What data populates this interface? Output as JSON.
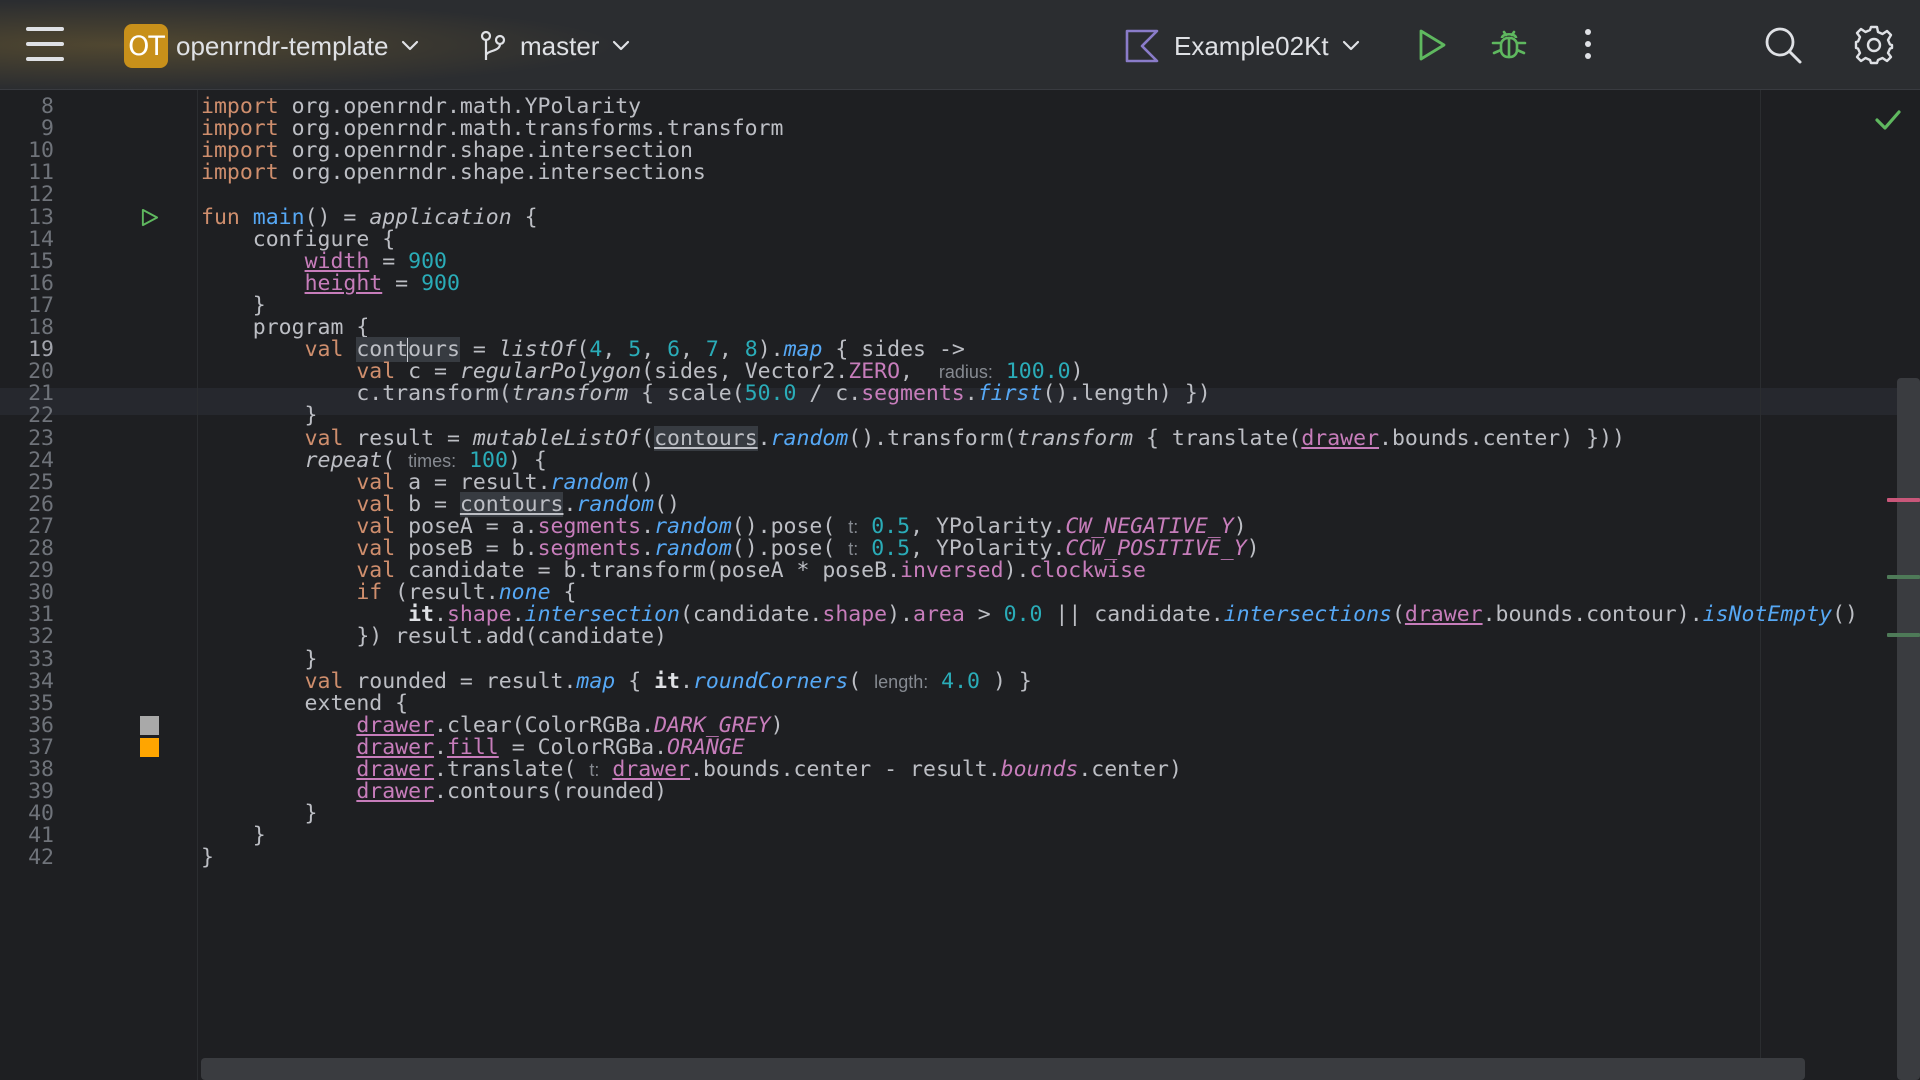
{
  "toolbar": {
    "project_badge": "OT",
    "project_name": "openrndr-template",
    "branch": "master",
    "run_config": "Example02Kt",
    "icons": [
      "menu-icon",
      "chevron-down-icon",
      "branch-icon",
      "kotlin-icon",
      "run-icon",
      "debug-icon",
      "more-icon",
      "search-icon",
      "gear-icon"
    ],
    "colors": {
      "badge": "#c8901a",
      "run": "#5fb85f",
      "debug": "#5fb85f"
    }
  },
  "editor": {
    "current_line": "19",
    "status": "check-icon",
    "colors": {
      "keyword": "#cf8e6d",
      "function": "#56a8f5",
      "number": "#2aacb8",
      "property": "#c77dbb",
      "swatch_grey": "#a9a9a9",
      "swatch_orange": "#ffa500"
    },
    "lines": [
      {
        "n": "8",
        "segs": [
          {
            "t": "import",
            "c": "kw"
          },
          {
            "t": " org.openrndr.math.YPolarity"
          }
        ]
      },
      {
        "n": "9",
        "segs": [
          {
            "t": "import",
            "c": "kw"
          },
          {
            "t": " org.openrndr.math.transforms.transform"
          }
        ]
      },
      {
        "n": "10",
        "segs": [
          {
            "t": "import",
            "c": "kw"
          },
          {
            "t": " org.openrndr.shape.intersection"
          }
        ]
      },
      {
        "n": "11",
        "segs": [
          {
            "t": "import",
            "c": "kw"
          },
          {
            "t": " org.openrndr.shape.intersections"
          }
        ]
      },
      {
        "n": "12",
        "segs": []
      },
      {
        "n": "13",
        "mark": "run",
        "segs": [
          {
            "t": "fun",
            "c": "kw"
          },
          {
            "t": " "
          },
          {
            "t": "main",
            "c": "fn"
          },
          {
            "t": "() = "
          },
          {
            "t": "application",
            "c": "it"
          },
          {
            "t": " {"
          }
        ]
      },
      {
        "n": "14",
        "segs": [
          {
            "t": "    configure {"
          }
        ]
      },
      {
        "n": "15",
        "segs": [
          {
            "t": "        "
          },
          {
            "t": "width",
            "c": "ulp"
          },
          {
            "t": " = "
          },
          {
            "t": "900",
            "c": "num"
          }
        ]
      },
      {
        "n": "16",
        "segs": [
          {
            "t": "        "
          },
          {
            "t": "height",
            "c": "ulp"
          },
          {
            "t": " = "
          },
          {
            "t": "900",
            "c": "num"
          }
        ]
      },
      {
        "n": "17",
        "segs": [
          {
            "t": "    }"
          }
        ]
      },
      {
        "n": "18",
        "segs": [
          {
            "t": "    program {"
          }
        ]
      },
      {
        "n": "19",
        "segs": [
          {
            "t": "        "
          },
          {
            "t": "val",
            "c": "kw"
          },
          {
            "t": " "
          },
          {
            "t": "cont",
            "c": "hl"
          },
          {
            "caret": true
          },
          {
            "t": "ours",
            "c": "hl"
          },
          {
            "t": " = "
          },
          {
            "t": "listOf",
            "c": "it"
          },
          {
            "t": "("
          },
          {
            "t": "4",
            "c": "num"
          },
          {
            "t": ", "
          },
          {
            "t": "5",
            "c": "num"
          },
          {
            "t": ", "
          },
          {
            "t": "6",
            "c": "num"
          },
          {
            "t": ", "
          },
          {
            "t": "7",
            "c": "num"
          },
          {
            "t": ", "
          },
          {
            "t": "8",
            "c": "num"
          },
          {
            "t": ")."
          },
          {
            "t": "map",
            "c": "fi"
          },
          {
            "t": " { sides ->"
          }
        ]
      },
      {
        "n": "20",
        "segs": [
          {
            "t": "            "
          },
          {
            "t": "val",
            "c": "kw"
          },
          {
            "t": " c = "
          },
          {
            "t": "regularPolygon",
            "c": "it"
          },
          {
            "t": "(sides, Vector2."
          },
          {
            "t": "ZERO",
            "c": "prop"
          },
          {
            "t": ",  "
          },
          {
            "h": "radius:"
          },
          {
            "t": " "
          },
          {
            "t": "100.0",
            "c": "num"
          },
          {
            "t": ")"
          }
        ]
      },
      {
        "n": "21",
        "segs": [
          {
            "t": "            c.transform("
          },
          {
            "t": "transform",
            "c": "it"
          },
          {
            "t": " { scale("
          },
          {
            "t": "50.0",
            "c": "num"
          },
          {
            "t": " / c."
          },
          {
            "t": "segments",
            "c": "prop"
          },
          {
            "t": "."
          },
          {
            "t": "first",
            "c": "fi"
          },
          {
            "t": "().length) })"
          }
        ]
      },
      {
        "n": "22",
        "segs": [
          {
            "t": "        }"
          }
        ]
      },
      {
        "n": "23",
        "segs": [
          {
            "t": "        "
          },
          {
            "t": "val",
            "c": "kw"
          },
          {
            "t": " result = "
          },
          {
            "t": "mutableListOf",
            "c": "it"
          },
          {
            "t": "("
          },
          {
            "t": "contours",
            "c": "ulhl"
          },
          {
            "t": "."
          },
          {
            "t": "random",
            "c": "fi"
          },
          {
            "t": "().transform("
          },
          {
            "t": "transform",
            "c": "it"
          },
          {
            "t": " { translate("
          },
          {
            "t": "drawer",
            "c": "ulp"
          },
          {
            "t": ".bounds.center) }))"
          }
        ]
      },
      {
        "n": "24",
        "segs": [
          {
            "t": "        "
          },
          {
            "t": "repeat",
            "c": "it"
          },
          {
            "t": "( "
          },
          {
            "h": "times:"
          },
          {
            "t": " "
          },
          {
            "t": "100",
            "c": "num"
          },
          {
            "t": ") {"
          }
        ]
      },
      {
        "n": "25",
        "segs": [
          {
            "t": "            "
          },
          {
            "t": "val",
            "c": "kw"
          },
          {
            "t": " a = result."
          },
          {
            "t": "random",
            "c": "fi"
          },
          {
            "t": "()"
          }
        ]
      },
      {
        "n": "26",
        "segs": [
          {
            "t": "            "
          },
          {
            "t": "val",
            "c": "kw"
          },
          {
            "t": " b = "
          },
          {
            "t": "contours",
            "c": "ulhl"
          },
          {
            "t": "."
          },
          {
            "t": "random",
            "c": "fi"
          },
          {
            "t": "()"
          }
        ]
      },
      {
        "n": "27",
        "segs": [
          {
            "t": "            "
          },
          {
            "t": "val",
            "c": "kw"
          },
          {
            "t": " poseA = a."
          },
          {
            "t": "segments",
            "c": "prop"
          },
          {
            "t": "."
          },
          {
            "t": "random",
            "c": "fi"
          },
          {
            "t": "().pose( "
          },
          {
            "h": "t:"
          },
          {
            "t": " "
          },
          {
            "t": "0.5",
            "c": "num"
          },
          {
            "t": ", YPolarity."
          },
          {
            "t": "CW_NEGATIVE_Y",
            "c": "pi"
          },
          {
            "t": ")"
          }
        ]
      },
      {
        "n": "28",
        "segs": [
          {
            "t": "            "
          },
          {
            "t": "val",
            "c": "kw"
          },
          {
            "t": " poseB = b."
          },
          {
            "t": "segments",
            "c": "prop"
          },
          {
            "t": "."
          },
          {
            "t": "random",
            "c": "fi"
          },
          {
            "t": "().pose( "
          },
          {
            "h": "t:"
          },
          {
            "t": " "
          },
          {
            "t": "0.5",
            "c": "num"
          },
          {
            "t": ", YPolarity."
          },
          {
            "t": "CCW_POSITIVE_Y",
            "c": "pi"
          },
          {
            "t": ")"
          }
        ]
      },
      {
        "n": "29",
        "segs": [
          {
            "t": "            "
          },
          {
            "t": "val",
            "c": "kw"
          },
          {
            "t": " candidate = b.transform(poseA * poseB."
          },
          {
            "t": "inversed",
            "c": "prop"
          },
          {
            "t": ")."
          },
          {
            "t": "clockwise",
            "c": "prop"
          }
        ]
      },
      {
        "n": "30",
        "segs": [
          {
            "t": "            "
          },
          {
            "t": "if",
            "c": "kw"
          },
          {
            "t": " (result."
          },
          {
            "t": "none",
            "c": "fi"
          },
          {
            "t": " {"
          }
        ]
      },
      {
        "n": "31",
        "segs": [
          {
            "t": "                "
          },
          {
            "t": "it",
            "c": "bold"
          },
          {
            "t": "."
          },
          {
            "t": "shape",
            "c": "prop"
          },
          {
            "t": "."
          },
          {
            "t": "intersection",
            "c": "fi"
          },
          {
            "t": "(candidate."
          },
          {
            "t": "shape",
            "c": "prop"
          },
          {
            "t": ")."
          },
          {
            "t": "area",
            "c": "prop"
          },
          {
            "t": " > "
          },
          {
            "t": "0.0",
            "c": "num"
          },
          {
            "t": " || candidate."
          },
          {
            "t": "intersections",
            "c": "fi"
          },
          {
            "t": "("
          },
          {
            "t": "drawer",
            "c": "ulp"
          },
          {
            "t": ".bounds.contour)."
          },
          {
            "t": "isNotEmpty",
            "c": "fi"
          },
          {
            "t": "()"
          }
        ]
      },
      {
        "n": "32",
        "segs": [
          {
            "t": "            }) result.add(candidate)"
          }
        ]
      },
      {
        "n": "33",
        "segs": [
          {
            "t": "        }"
          }
        ]
      },
      {
        "n": "34",
        "segs": [
          {
            "t": "        "
          },
          {
            "t": "val",
            "c": "kw"
          },
          {
            "t": " rounded = result."
          },
          {
            "t": "map",
            "c": "fi"
          },
          {
            "t": " { "
          },
          {
            "t": "it",
            "c": "bold"
          },
          {
            "t": "."
          },
          {
            "t": "roundCorners",
            "c": "fi"
          },
          {
            "t": "( "
          },
          {
            "h": "length:"
          },
          {
            "t": " "
          },
          {
            "t": "4.0",
            "c": "num"
          },
          {
            "t": " ) }"
          }
        ]
      },
      {
        "n": "35",
        "segs": [
          {
            "t": "        extend {"
          }
        ]
      },
      {
        "n": "36",
        "mark": "swatch_grey",
        "segs": [
          {
            "t": "            "
          },
          {
            "t": "drawer",
            "c": "ulp"
          },
          {
            "t": ".clear(ColorRGBa."
          },
          {
            "t": "DARK_GREY",
            "c": "pi"
          },
          {
            "t": ")"
          }
        ]
      },
      {
        "n": "37",
        "mark": "swatch_orange",
        "segs": [
          {
            "t": "            "
          },
          {
            "t": "drawer",
            "c": "ulp"
          },
          {
            "t": "."
          },
          {
            "t": "fill",
            "c": "ulp"
          },
          {
            "t": " = ColorRGBa."
          },
          {
            "t": "ORANGE",
            "c": "pi"
          }
        ]
      },
      {
        "n": "38",
        "segs": [
          {
            "t": "            "
          },
          {
            "t": "drawer",
            "c": "ulp"
          },
          {
            "t": ".translate( "
          },
          {
            "h": "t:"
          },
          {
            "t": " "
          },
          {
            "t": "drawer",
            "c": "ulp"
          },
          {
            "t": ".bounds.center - result."
          },
          {
            "t": "bounds",
            "c": "pi"
          },
          {
            "t": ".center)"
          }
        ]
      },
      {
        "n": "39",
        "segs": [
          {
            "t": "            "
          },
          {
            "t": "drawer",
            "c": "ulp"
          },
          {
            "t": ".contours(rounded)"
          }
        ]
      },
      {
        "n": "40",
        "segs": [
          {
            "t": "        }"
          }
        ]
      },
      {
        "n": "41",
        "segs": [
          {
            "t": "    }"
          }
        ]
      },
      {
        "n": "42",
        "segs": [
          {
            "t": "}"
          }
        ]
      }
    ]
  }
}
